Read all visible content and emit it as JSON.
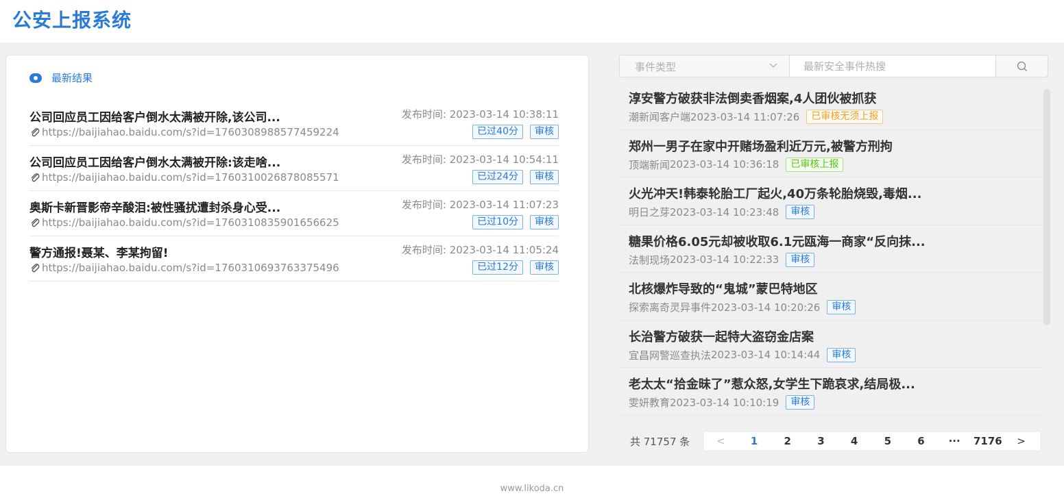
{
  "app_title": "公安上报系统",
  "left": {
    "section_label": "最新结果",
    "publish_label": "发布时间:",
    "items": [
      {
        "title": "公司回应员工因给客户倒水太满被开除,该公司...",
        "time": "2023-03-14 10:38:11",
        "url": "https://baijiahao.baidu.com/s?id=1760308988577459224",
        "elapsed": "已过40分",
        "action": "审核"
      },
      {
        "title": "公司回应员工因给客户倒水太满被开除:该走啥...",
        "time": "2023-03-14 10:54:11",
        "url": "https://baijiahao.baidu.com/s?id=1760310026878085571",
        "elapsed": "已过24分",
        "action": "审核"
      },
      {
        "title": "奥斯卡新晋影帝辛酸泪:被性骚扰遭封杀身心受...",
        "time": "2023-03-14 11:07:23",
        "url": "https://baijiahao.baidu.com/s?id=1760310835901656625",
        "elapsed": "已过10分",
        "action": "审核"
      },
      {
        "title": "警方通报!聂某、李某拘留!",
        "time": "2023-03-14 11:05:24",
        "url": "https://baijiahao.baidu.com/s?id=1760310693763375496",
        "elapsed": "已过12分",
        "action": "审核"
      }
    ]
  },
  "right": {
    "select_placeholder": "事件类型",
    "search_placeholder": "最新安全事件热搜",
    "items": [
      {
        "title": "淳安警方破获非法倒卖香烟案,4人团伙被抓获",
        "source": "潮新闻客户端",
        "time": "2023-03-14 11:07:26",
        "status": "已审核无须上报",
        "status_kind": "orange"
      },
      {
        "title": "郑州一男子在家中开赌场盈利近万元,被警方刑拘",
        "source": "顶端新闻",
        "time": "2023-03-14 10:36:18",
        "status": "已审核上报",
        "status_kind": "green"
      },
      {
        "title": "火光冲天!韩泰轮胎工厂起火,40万条轮胎烧毁,毒烟...",
        "source": "明日之芽",
        "time": "2023-03-14 10:23:48",
        "status": "审核",
        "status_kind": "blue"
      },
      {
        "title": "糖果价格6.05元却被收取6.1元瓯海一商家“反向抹...",
        "source": "法制现场",
        "time": "2023-03-14 10:22:33",
        "status": "审核",
        "status_kind": "blue"
      },
      {
        "title": "北核爆炸导致的“鬼城”蒙巴特地区",
        "source": "探索离奇灵异事件",
        "time": "2023-03-14 10:20:26",
        "status": "审核",
        "status_kind": "blue"
      },
      {
        "title": "长治警方破获一起特大盗窃金店案",
        "source": "宜昌网警巡查执法",
        "time": "2023-03-14 10:14:44",
        "status": "审核",
        "status_kind": "blue"
      },
      {
        "title": "老太太“拾金昧了”惹众怒,女学生下跪哀求,结局极...",
        "source": "雯妍教育",
        "time": "2023-03-14 10:10:19",
        "status": "审核",
        "status_kind": "blue"
      }
    ],
    "pagination": {
      "total_text": "共 71757 条",
      "prev": "<",
      "pages": [
        "1",
        "2",
        "3",
        "4",
        "5",
        "6",
        "···",
        "7176"
      ],
      "current": "1",
      "next": ">"
    }
  },
  "footer": "www.likoda.cn",
  "colors": {
    "accent": "#2a7ad8",
    "orange": "#f0a020",
    "green": "#52c41a"
  }
}
